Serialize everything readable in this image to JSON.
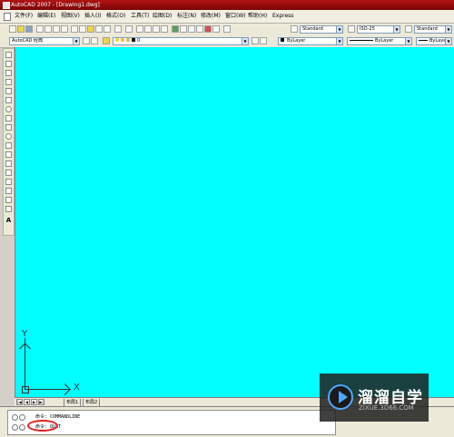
{
  "window": {
    "title": "AutoCAD 2007 - [Drawing1.dwg]"
  },
  "menu": [
    "文件(F)",
    "编辑(E)",
    "视图(V)",
    "插入(I)",
    "格式(O)",
    "工具(T)",
    "绘图(D)",
    "标注(N)",
    "修改(M)",
    "窗口(W)",
    "帮助(H)",
    "Express"
  ],
  "styles": {
    "text_style": "Standard",
    "dim_style": "ISO-25",
    "table_style": "Standard"
  },
  "layers": {
    "workspace": "AutoCAD 经典",
    "layer": "0",
    "color": "ByLayer",
    "linetype": "ByLayer",
    "lineweight": "ByLayer"
  },
  "ucs": {
    "x": "X",
    "y": "Y"
  },
  "tabs": [
    "布局1",
    "布局2"
  ],
  "command": {
    "history": "命令: COMMANDLINE",
    "prompt": "命令: QUIT"
  },
  "watermark": {
    "title": "溜溜自学",
    "url": "ZIXUE.3D66.COM"
  },
  "colors": {
    "canvas": "#00ffff",
    "titlebar": "#9a0b0b",
    "highlight": "#e02020"
  }
}
